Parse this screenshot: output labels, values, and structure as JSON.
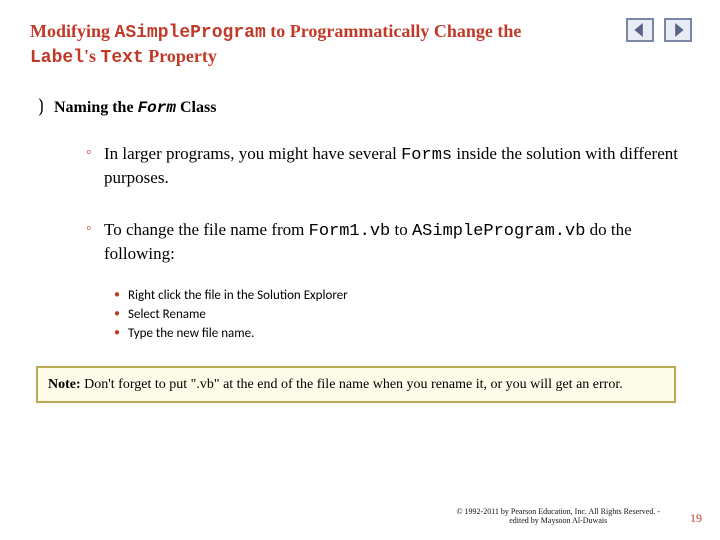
{
  "title": {
    "before_prog": "Modifying ",
    "prog": "ASimpleProgram",
    "mid": " to Programmatically Change the ",
    "label": "Label",
    "poss": "'s ",
    "text_prop": "Text",
    "after": " Property"
  },
  "nav": {
    "prev_name": "prev-slide",
    "next_name": "next-slide"
  },
  "subhead": {
    "prefix": "Naming the ",
    "mono": "Form",
    "suffix": " Class"
  },
  "bullet1": {
    "a": "In larger programs, you might have several ",
    "forms": "Forms",
    "b": " inside the solution with different purposes."
  },
  "bullet2": {
    "a": "To change the file name from ",
    "f1": "Form1.vb",
    "b": " to ",
    "f2": "ASimpleProgram.vb",
    "c": " do the following:"
  },
  "steps": [
    "Right click the file in the Solution Explorer",
    "Select Rename",
    "Type the new file name."
  ],
  "note": {
    "label": "Note:",
    "body": " Don't forget to put \".vb\" at the end of the file name when you rename it, or you will get an error."
  },
  "footer": {
    "copy1": "© 1992-2011 by Pearson Education, Inc. All Rights Reserved. -",
    "copy2": "edited by Maysoon Al-Duwais",
    "page": "19"
  }
}
